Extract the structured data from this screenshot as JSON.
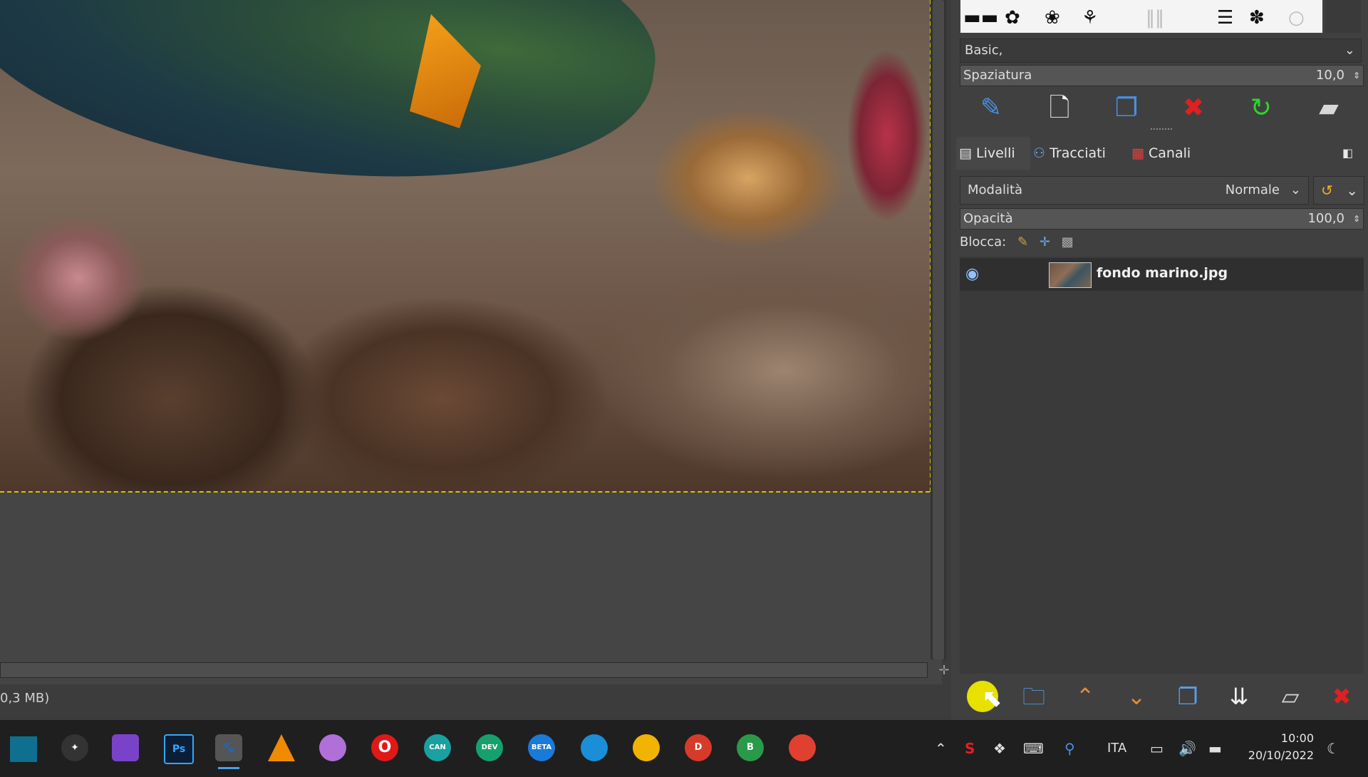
{
  "status": {
    "memory_text": "0,3 MB)"
  },
  "brushes": {
    "preset": "Basic,",
    "spacing_label": "Spaziatura",
    "spacing_value": "10,0"
  },
  "tabs": [
    {
      "label": "Livelli",
      "icon": "layers-icon"
    },
    {
      "label": "Tracciati",
      "icon": "paths-icon"
    },
    {
      "label": "Canali",
      "icon": "channels-icon"
    }
  ],
  "layers": {
    "mode_label": "Modalità",
    "mode_value": "Normale",
    "opacity_label": "Opacità",
    "opacity_value": "100,0",
    "lock_label": "Blocca:",
    "items": [
      {
        "name": "fondo marino.jpg",
        "visible": true
      }
    ]
  },
  "taskbar": {
    "apps": [
      {
        "name": "davinci-resolve-icon",
        "label": ""
      },
      {
        "name": "clapper-icon",
        "label": ""
      },
      {
        "name": "photoshop-icon",
        "label": "Ps"
      },
      {
        "name": "gimp-icon",
        "label": ""
      },
      {
        "name": "vlc-icon",
        "label": ""
      },
      {
        "name": "onedrive-icon",
        "label": ""
      },
      {
        "name": "opera-icon",
        "label": "O"
      },
      {
        "name": "edge-canary-icon",
        "label": "CAN"
      },
      {
        "name": "edge-dev-icon",
        "label": "DEV"
      },
      {
        "name": "edge-beta-icon",
        "label": "BETA"
      },
      {
        "name": "edge-icon",
        "label": ""
      },
      {
        "name": "chrome-canary-icon",
        "label": ""
      },
      {
        "name": "chrome-dev-icon",
        "label": "D"
      },
      {
        "name": "chrome-beta-icon",
        "label": "B"
      },
      {
        "name": "chrome-icon",
        "label": ""
      }
    ],
    "language": "ITA",
    "time": "10:00",
    "date": "20/10/2022"
  },
  "colors": {
    "accent_yellow": "#d8c200",
    "red": "#e02020",
    "green": "#2bd62b"
  }
}
